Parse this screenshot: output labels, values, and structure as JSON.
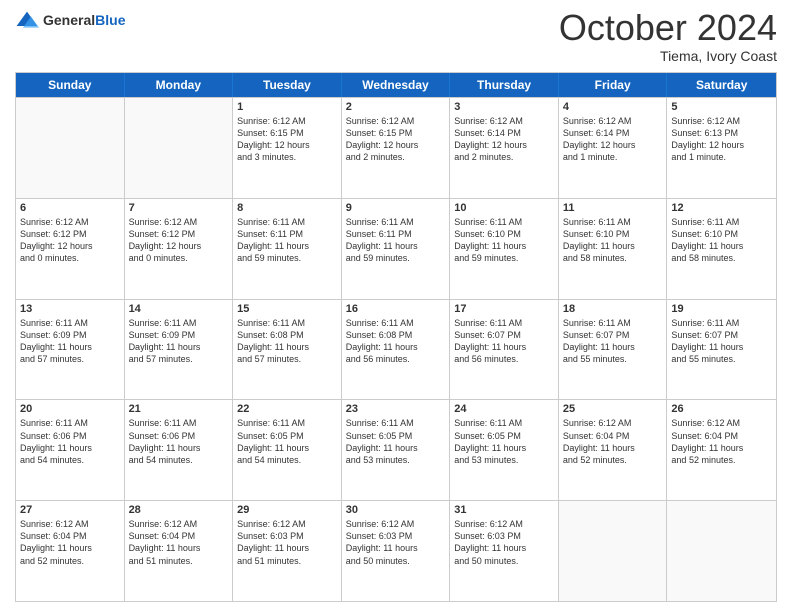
{
  "header": {
    "logo_general": "General",
    "logo_blue": "Blue",
    "month": "October 2024",
    "location": "Tiema, Ivory Coast"
  },
  "weekdays": [
    "Sunday",
    "Monday",
    "Tuesday",
    "Wednesday",
    "Thursday",
    "Friday",
    "Saturday"
  ],
  "rows": [
    [
      {
        "day": "",
        "lines": []
      },
      {
        "day": "",
        "lines": []
      },
      {
        "day": "1",
        "lines": [
          "Sunrise: 6:12 AM",
          "Sunset: 6:15 PM",
          "Daylight: 12 hours",
          "and 3 minutes."
        ]
      },
      {
        "day": "2",
        "lines": [
          "Sunrise: 6:12 AM",
          "Sunset: 6:15 PM",
          "Daylight: 12 hours",
          "and 2 minutes."
        ]
      },
      {
        "day": "3",
        "lines": [
          "Sunrise: 6:12 AM",
          "Sunset: 6:14 PM",
          "Daylight: 12 hours",
          "and 2 minutes."
        ]
      },
      {
        "day": "4",
        "lines": [
          "Sunrise: 6:12 AM",
          "Sunset: 6:14 PM",
          "Daylight: 12 hours",
          "and 1 minute."
        ]
      },
      {
        "day": "5",
        "lines": [
          "Sunrise: 6:12 AM",
          "Sunset: 6:13 PM",
          "Daylight: 12 hours",
          "and 1 minute."
        ]
      }
    ],
    [
      {
        "day": "6",
        "lines": [
          "Sunrise: 6:12 AM",
          "Sunset: 6:12 PM",
          "Daylight: 12 hours",
          "and 0 minutes."
        ]
      },
      {
        "day": "7",
        "lines": [
          "Sunrise: 6:12 AM",
          "Sunset: 6:12 PM",
          "Daylight: 12 hours",
          "and 0 minutes."
        ]
      },
      {
        "day": "8",
        "lines": [
          "Sunrise: 6:11 AM",
          "Sunset: 6:11 PM",
          "Daylight: 11 hours",
          "and 59 minutes."
        ]
      },
      {
        "day": "9",
        "lines": [
          "Sunrise: 6:11 AM",
          "Sunset: 6:11 PM",
          "Daylight: 11 hours",
          "and 59 minutes."
        ]
      },
      {
        "day": "10",
        "lines": [
          "Sunrise: 6:11 AM",
          "Sunset: 6:10 PM",
          "Daylight: 11 hours",
          "and 59 minutes."
        ]
      },
      {
        "day": "11",
        "lines": [
          "Sunrise: 6:11 AM",
          "Sunset: 6:10 PM",
          "Daylight: 11 hours",
          "and 58 minutes."
        ]
      },
      {
        "day": "12",
        "lines": [
          "Sunrise: 6:11 AM",
          "Sunset: 6:10 PM",
          "Daylight: 11 hours",
          "and 58 minutes."
        ]
      }
    ],
    [
      {
        "day": "13",
        "lines": [
          "Sunrise: 6:11 AM",
          "Sunset: 6:09 PM",
          "Daylight: 11 hours",
          "and 57 minutes."
        ]
      },
      {
        "day": "14",
        "lines": [
          "Sunrise: 6:11 AM",
          "Sunset: 6:09 PM",
          "Daylight: 11 hours",
          "and 57 minutes."
        ]
      },
      {
        "day": "15",
        "lines": [
          "Sunrise: 6:11 AM",
          "Sunset: 6:08 PM",
          "Daylight: 11 hours",
          "and 57 minutes."
        ]
      },
      {
        "day": "16",
        "lines": [
          "Sunrise: 6:11 AM",
          "Sunset: 6:08 PM",
          "Daylight: 11 hours",
          "and 56 minutes."
        ]
      },
      {
        "day": "17",
        "lines": [
          "Sunrise: 6:11 AM",
          "Sunset: 6:07 PM",
          "Daylight: 11 hours",
          "and 56 minutes."
        ]
      },
      {
        "day": "18",
        "lines": [
          "Sunrise: 6:11 AM",
          "Sunset: 6:07 PM",
          "Daylight: 11 hours",
          "and 55 minutes."
        ]
      },
      {
        "day": "19",
        "lines": [
          "Sunrise: 6:11 AM",
          "Sunset: 6:07 PM",
          "Daylight: 11 hours",
          "and 55 minutes."
        ]
      }
    ],
    [
      {
        "day": "20",
        "lines": [
          "Sunrise: 6:11 AM",
          "Sunset: 6:06 PM",
          "Daylight: 11 hours",
          "and 54 minutes."
        ]
      },
      {
        "day": "21",
        "lines": [
          "Sunrise: 6:11 AM",
          "Sunset: 6:06 PM",
          "Daylight: 11 hours",
          "and 54 minutes."
        ]
      },
      {
        "day": "22",
        "lines": [
          "Sunrise: 6:11 AM",
          "Sunset: 6:05 PM",
          "Daylight: 11 hours",
          "and 54 minutes."
        ]
      },
      {
        "day": "23",
        "lines": [
          "Sunrise: 6:11 AM",
          "Sunset: 6:05 PM",
          "Daylight: 11 hours",
          "and 53 minutes."
        ]
      },
      {
        "day": "24",
        "lines": [
          "Sunrise: 6:11 AM",
          "Sunset: 6:05 PM",
          "Daylight: 11 hours",
          "and 53 minutes."
        ]
      },
      {
        "day": "25",
        "lines": [
          "Sunrise: 6:12 AM",
          "Sunset: 6:04 PM",
          "Daylight: 11 hours",
          "and 52 minutes."
        ]
      },
      {
        "day": "26",
        "lines": [
          "Sunrise: 6:12 AM",
          "Sunset: 6:04 PM",
          "Daylight: 11 hours",
          "and 52 minutes."
        ]
      }
    ],
    [
      {
        "day": "27",
        "lines": [
          "Sunrise: 6:12 AM",
          "Sunset: 6:04 PM",
          "Daylight: 11 hours",
          "and 52 minutes."
        ]
      },
      {
        "day": "28",
        "lines": [
          "Sunrise: 6:12 AM",
          "Sunset: 6:04 PM",
          "Daylight: 11 hours",
          "and 51 minutes."
        ]
      },
      {
        "day": "29",
        "lines": [
          "Sunrise: 6:12 AM",
          "Sunset: 6:03 PM",
          "Daylight: 11 hours",
          "and 51 minutes."
        ]
      },
      {
        "day": "30",
        "lines": [
          "Sunrise: 6:12 AM",
          "Sunset: 6:03 PM",
          "Daylight: 11 hours",
          "and 50 minutes."
        ]
      },
      {
        "day": "31",
        "lines": [
          "Sunrise: 6:12 AM",
          "Sunset: 6:03 PM",
          "Daylight: 11 hours",
          "and 50 minutes."
        ]
      },
      {
        "day": "",
        "lines": []
      },
      {
        "day": "",
        "lines": []
      }
    ]
  ]
}
